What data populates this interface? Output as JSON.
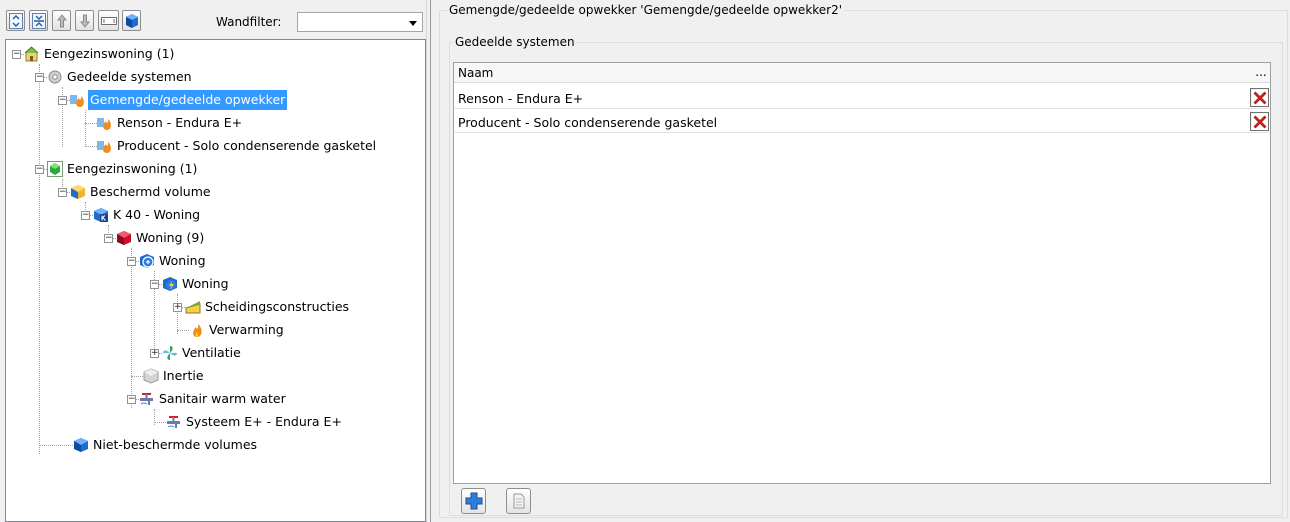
{
  "toolbar": {
    "buttons": [
      {
        "icon": "expand-all-icon"
      },
      {
        "icon": "collapse-all-icon"
      },
      {
        "icon": "arrow-up-icon"
      },
      {
        "icon": "arrow-down-icon"
      },
      {
        "icon": "text-field-icon"
      },
      {
        "icon": "cube-view-icon"
      }
    ],
    "wandfilter_label": "Wandfilter:",
    "wandfilter_value": ""
  },
  "tree": {
    "nodes": [
      {
        "label": "Eengezinswoning (1)",
        "icon": "building-icon",
        "selected": false
      },
      {
        "label": "Gedeelde systemen",
        "icon": "gear-icon",
        "selected": false
      },
      {
        "label": "Gemengde/gedeelde opwekker",
        "icon": "flame-system-icon",
        "selected": true
      },
      {
        "label": "Renson - Endura E+",
        "icon": "flame-system-icon",
        "selected": false
      },
      {
        "label": "Producent - Solo condenserende gasketel",
        "icon": "flame-system-icon",
        "selected": false
      },
      {
        "label": "Eengezinswoning (1)",
        "icon": "green-cube-icon",
        "selected": false
      },
      {
        "label": "Beschermd volume",
        "icon": "volume-icon",
        "selected": false
      },
      {
        "label": "K 40 - Woning",
        "icon": "k-value-icon",
        "selected": false
      },
      {
        "label": "Woning (9)",
        "icon": "red-cube-icon",
        "selected": false
      },
      {
        "label": "Woning",
        "icon": "energy-sector-icon",
        "selected": false
      },
      {
        "label": "Woning",
        "icon": "energy-zone-icon",
        "selected": false
      },
      {
        "label": "Scheidingsconstructies",
        "icon": "wall-icon",
        "selected": false
      },
      {
        "label": "Verwarming",
        "icon": "flame-icon",
        "selected": false
      },
      {
        "label": "Ventilatie",
        "icon": "fan-icon",
        "selected": false
      },
      {
        "label": "Inertie",
        "icon": "inertia-icon",
        "selected": false
      },
      {
        "label": "Sanitair warm water",
        "icon": "faucet-icon",
        "selected": false
      },
      {
        "label": "Systeem E+ - Endura E+",
        "icon": "faucet-icon",
        "selected": false
      },
      {
        "label": "Niet-beschermde volumes",
        "icon": "blue-cube-icon",
        "selected": false
      }
    ]
  },
  "right": {
    "group_title": "Gemengde/gedeelde opwekker 'Gemengde/gedeelde opwekker2'",
    "subgroup_title": "Gedeelde systemen",
    "grid": {
      "column_header": "Naam",
      "more_label": "...",
      "rows": [
        {
          "name": "Renson - Endura E+"
        },
        {
          "name": "Producent - Solo condenserende gasketel"
        }
      ]
    },
    "buttons": [
      {
        "icon": "add-icon"
      },
      {
        "icon": "copy-icon"
      }
    ]
  },
  "colors": {
    "selection": "#3399ff",
    "delete_red": "#d8261c",
    "add_blue": "#2d7fd8"
  }
}
